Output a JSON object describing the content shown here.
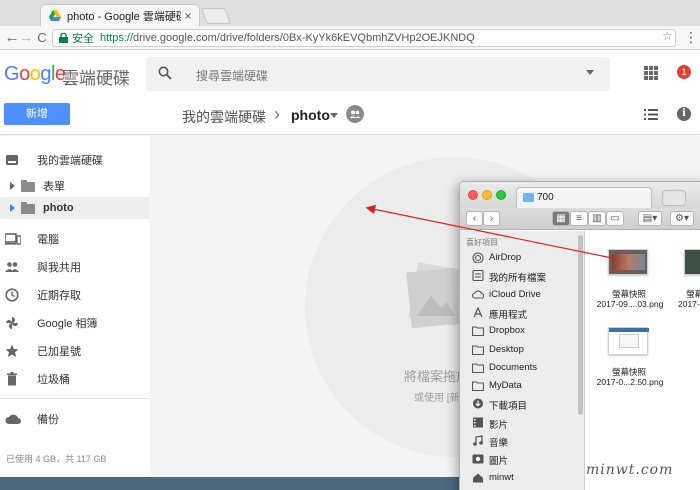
{
  "browser": {
    "tab_title": "photo - Google 雲端硬碟",
    "tab_close": "×",
    "secure_label": "安全",
    "url_prefix": "https://",
    "url_rest": "drive.google.com/drive/folders/0Bx-KyYk6kEVQbmhZVHp2OEJKNDQ",
    "back": "←",
    "forward": "→",
    "reload": "C"
  },
  "header": {
    "logo_text": "Google",
    "product_name": "雲端硬碟",
    "search_placeholder": "搜尋雲端硬碟",
    "notification_count": "1"
  },
  "toolbar": {
    "new_button": "新增",
    "breadcrumb_root": "我的雲端硬碟",
    "breadcrumb_sep": "›",
    "breadcrumb_current": "photo",
    "info_label": "i"
  },
  "sidebar": {
    "items": [
      {
        "label": "我的雲端硬碟"
      },
      {
        "label": "表單"
      },
      {
        "label": "photo"
      },
      {
        "label": "電腦"
      },
      {
        "label": "與我共用"
      },
      {
        "label": "近期存取"
      },
      {
        "label": "Google 相簿"
      },
      {
        "label": "已加星號"
      },
      {
        "label": "垃圾桶"
      },
      {
        "label": "備份"
      }
    ],
    "storage_text": "已使用 4 GB，共 117 GB"
  },
  "main": {
    "drop_text": "將檔案拖放",
    "drop_sub": "或使用 [新增"
  },
  "finder": {
    "tab_title": "700",
    "sidebar_header": "喜好項目",
    "items": [
      {
        "label": "AirDrop",
        "icon": "airdrop-icon"
      },
      {
        "label": "我的所有檔案",
        "icon": "all-files-icon"
      },
      {
        "label": "iCloud Drive",
        "icon": "icloud-icon"
      },
      {
        "label": "應用程式",
        "icon": "applications-icon"
      },
      {
        "label": "Dropbox",
        "icon": "folder-icon"
      },
      {
        "label": "Desktop",
        "icon": "folder-icon"
      },
      {
        "label": "Documents",
        "icon": "folder-icon"
      },
      {
        "label": "MyData",
        "icon": "folder-icon"
      },
      {
        "label": "下載項目",
        "icon": "downloads-icon"
      },
      {
        "label": "影片",
        "icon": "movies-icon"
      },
      {
        "label": "音樂",
        "icon": "music-icon"
      },
      {
        "label": "圖片",
        "icon": "pictures-icon"
      },
      {
        "label": "minwt",
        "icon": "home-icon"
      }
    ],
    "files": [
      {
        "name": "螢幕快照",
        "date": "2017-09....03.png"
      },
      {
        "name": "螢幕",
        "date": "2017-0"
      },
      {
        "name": "螢幕快照",
        "date": "2017-0...2.50.png"
      }
    ]
  },
  "watermark": "minwt.com",
  "colors": {
    "accent_blue": "#4d90fe",
    "arrow_red": "#e0201f",
    "notification_red": "#db4437",
    "secure_green": "#0b8043"
  }
}
